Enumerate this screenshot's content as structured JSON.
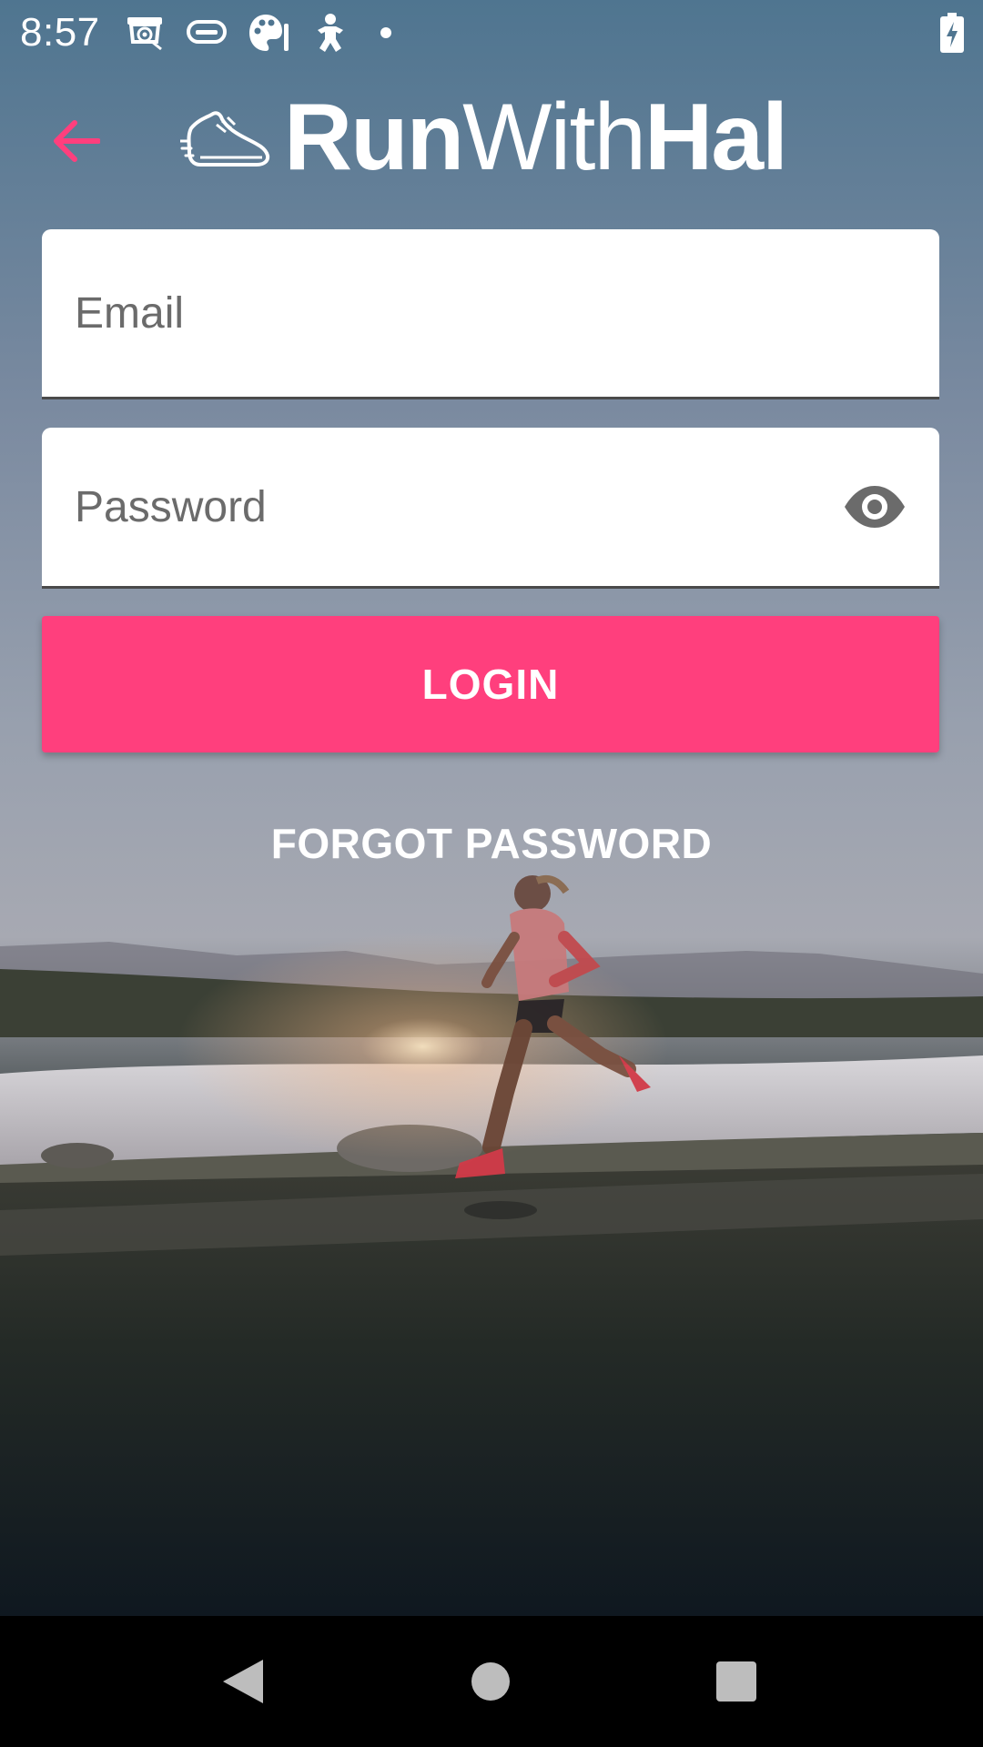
{
  "status_bar": {
    "time": "8:57",
    "icons": [
      "camera-icon",
      "game-controller-icon",
      "palette-icon",
      "baby-icon",
      "notification-dot-icon",
      "battery-charging-icon"
    ]
  },
  "header": {
    "back_icon": "arrow-left-icon",
    "brand": {
      "logo_icon": "running-shoe-icon",
      "run": "Run",
      "with": "With",
      "hal": "Hal"
    }
  },
  "form": {
    "email": {
      "placeholder": "Email",
      "value": ""
    },
    "password": {
      "placeholder": "Password",
      "value": "",
      "toggle_icon": "eye-icon"
    },
    "login_label": "LOGIN",
    "forgot_label": "FORGOT PASSWORD"
  },
  "nav_bar": {
    "back_icon": "triangle-back-icon",
    "home_icon": "circle-home-icon",
    "recents_icon": "square-recents-icon"
  },
  "colors": {
    "accent": "#ff3f7d",
    "back_arrow": "#ff3f7d",
    "field_background": "#ffffff",
    "text_on_image": "#ffffff"
  }
}
